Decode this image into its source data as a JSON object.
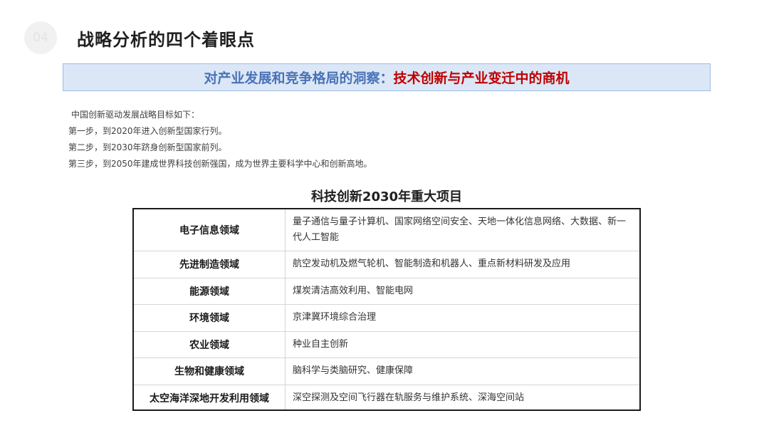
{
  "header": {
    "section_number": "04",
    "title": "战略分析的四个着眼点"
  },
  "banner": {
    "lead": "对产业发展和竞争格局的洞察：",
    "highlight": "技术创新与产业变迁中的商机"
  },
  "goals": {
    "intro": "中国创新驱动发展战略目标如下：",
    "steps": [
      "第一步，到2020年进入创新型国家行列。",
      "第二步，到2030年跻身创新型国家前列。",
      "第三步，到2050年建成世界科技创新强国，成为世界主要科学中心和创新高地。"
    ]
  },
  "table": {
    "title": "科技创新2030年重大项目",
    "rows": [
      {
        "domain": "电子信息领域",
        "projects": "量子通信与量子计算机、国家网络空间安全、天地一体化信息网络、大数据、新一 代人工智能"
      },
      {
        "domain": "先进制造领域",
        "projects": "航空发动机及燃气轮机、智能制造和机器人、重点新材料研发及应用"
      },
      {
        "domain": "能源领域",
        "projects": "煤炭清洁高效利用、智能电网"
      },
      {
        "domain": "环境领域",
        "projects": "京津冀环境综合治理"
      },
      {
        "domain": "农业领域",
        "projects": "种业自主创新"
      },
      {
        "domain": "生物和健康领域",
        "projects": "脑科学与类脑研究、健康保障"
      },
      {
        "domain": "太空海洋深地开发利用领域",
        "projects": "深空探测及空间飞行器在轨服务与维护系统、深海空间站"
      }
    ]
  },
  "colors": {
    "banner_lead": "#4a72b8",
    "banner_highlight": "#c00000",
    "banner_background": "#dbe7f6"
  }
}
